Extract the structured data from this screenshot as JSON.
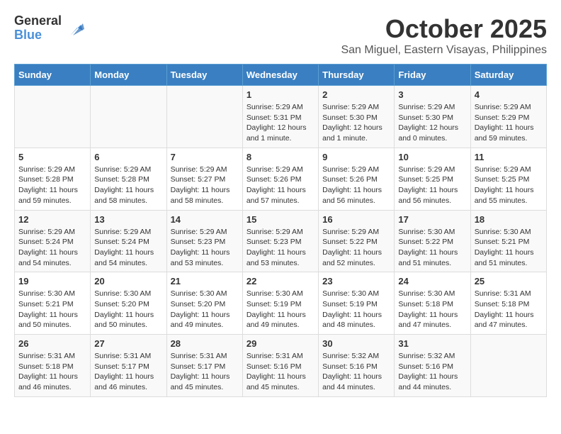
{
  "logo": {
    "general": "General",
    "blue": "Blue"
  },
  "header": {
    "month": "October 2025",
    "location": "San Miguel, Eastern Visayas, Philippines"
  },
  "weekdays": [
    "Sunday",
    "Monday",
    "Tuesday",
    "Wednesday",
    "Thursday",
    "Friday",
    "Saturday"
  ],
  "weeks": [
    [
      {
        "day": "",
        "info": ""
      },
      {
        "day": "",
        "info": ""
      },
      {
        "day": "",
        "info": ""
      },
      {
        "day": "1",
        "info": "Sunrise: 5:29 AM\nSunset: 5:31 PM\nDaylight: 12 hours\nand 1 minute."
      },
      {
        "day": "2",
        "info": "Sunrise: 5:29 AM\nSunset: 5:30 PM\nDaylight: 12 hours\nand 1 minute."
      },
      {
        "day": "3",
        "info": "Sunrise: 5:29 AM\nSunset: 5:30 PM\nDaylight: 12 hours\nand 0 minutes."
      },
      {
        "day": "4",
        "info": "Sunrise: 5:29 AM\nSunset: 5:29 PM\nDaylight: 11 hours\nand 59 minutes."
      }
    ],
    [
      {
        "day": "5",
        "info": "Sunrise: 5:29 AM\nSunset: 5:28 PM\nDaylight: 11 hours\nand 59 minutes."
      },
      {
        "day": "6",
        "info": "Sunrise: 5:29 AM\nSunset: 5:28 PM\nDaylight: 11 hours\nand 58 minutes."
      },
      {
        "day": "7",
        "info": "Sunrise: 5:29 AM\nSunset: 5:27 PM\nDaylight: 11 hours\nand 58 minutes."
      },
      {
        "day": "8",
        "info": "Sunrise: 5:29 AM\nSunset: 5:26 PM\nDaylight: 11 hours\nand 57 minutes."
      },
      {
        "day": "9",
        "info": "Sunrise: 5:29 AM\nSunset: 5:26 PM\nDaylight: 11 hours\nand 56 minutes."
      },
      {
        "day": "10",
        "info": "Sunrise: 5:29 AM\nSunset: 5:25 PM\nDaylight: 11 hours\nand 56 minutes."
      },
      {
        "day": "11",
        "info": "Sunrise: 5:29 AM\nSunset: 5:25 PM\nDaylight: 11 hours\nand 55 minutes."
      }
    ],
    [
      {
        "day": "12",
        "info": "Sunrise: 5:29 AM\nSunset: 5:24 PM\nDaylight: 11 hours\nand 54 minutes."
      },
      {
        "day": "13",
        "info": "Sunrise: 5:29 AM\nSunset: 5:24 PM\nDaylight: 11 hours\nand 54 minutes."
      },
      {
        "day": "14",
        "info": "Sunrise: 5:29 AM\nSunset: 5:23 PM\nDaylight: 11 hours\nand 53 minutes."
      },
      {
        "day": "15",
        "info": "Sunrise: 5:29 AM\nSunset: 5:23 PM\nDaylight: 11 hours\nand 53 minutes."
      },
      {
        "day": "16",
        "info": "Sunrise: 5:29 AM\nSunset: 5:22 PM\nDaylight: 11 hours\nand 52 minutes."
      },
      {
        "day": "17",
        "info": "Sunrise: 5:30 AM\nSunset: 5:22 PM\nDaylight: 11 hours\nand 51 minutes."
      },
      {
        "day": "18",
        "info": "Sunrise: 5:30 AM\nSunset: 5:21 PM\nDaylight: 11 hours\nand 51 minutes."
      }
    ],
    [
      {
        "day": "19",
        "info": "Sunrise: 5:30 AM\nSunset: 5:21 PM\nDaylight: 11 hours\nand 50 minutes."
      },
      {
        "day": "20",
        "info": "Sunrise: 5:30 AM\nSunset: 5:20 PM\nDaylight: 11 hours\nand 50 minutes."
      },
      {
        "day": "21",
        "info": "Sunrise: 5:30 AM\nSunset: 5:20 PM\nDaylight: 11 hours\nand 49 minutes."
      },
      {
        "day": "22",
        "info": "Sunrise: 5:30 AM\nSunset: 5:19 PM\nDaylight: 11 hours\nand 49 minutes."
      },
      {
        "day": "23",
        "info": "Sunrise: 5:30 AM\nSunset: 5:19 PM\nDaylight: 11 hours\nand 48 minutes."
      },
      {
        "day": "24",
        "info": "Sunrise: 5:30 AM\nSunset: 5:18 PM\nDaylight: 11 hours\nand 47 minutes."
      },
      {
        "day": "25",
        "info": "Sunrise: 5:31 AM\nSunset: 5:18 PM\nDaylight: 11 hours\nand 47 minutes."
      }
    ],
    [
      {
        "day": "26",
        "info": "Sunrise: 5:31 AM\nSunset: 5:18 PM\nDaylight: 11 hours\nand 46 minutes."
      },
      {
        "day": "27",
        "info": "Sunrise: 5:31 AM\nSunset: 5:17 PM\nDaylight: 11 hours\nand 46 minutes."
      },
      {
        "day": "28",
        "info": "Sunrise: 5:31 AM\nSunset: 5:17 PM\nDaylight: 11 hours\nand 45 minutes."
      },
      {
        "day": "29",
        "info": "Sunrise: 5:31 AM\nSunset: 5:16 PM\nDaylight: 11 hours\nand 45 minutes."
      },
      {
        "day": "30",
        "info": "Sunrise: 5:32 AM\nSunset: 5:16 PM\nDaylight: 11 hours\nand 44 minutes."
      },
      {
        "day": "31",
        "info": "Sunrise: 5:32 AM\nSunset: 5:16 PM\nDaylight: 11 hours\nand 44 minutes."
      },
      {
        "day": "",
        "info": ""
      }
    ]
  ]
}
